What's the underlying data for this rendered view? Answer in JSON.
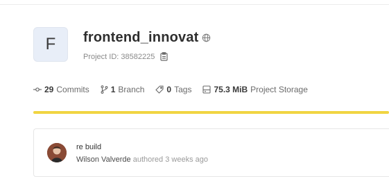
{
  "project": {
    "avatar_letter": "F",
    "name": "frontend_innovat",
    "id_label": "Project ID: 38582225",
    "visibility_icon": "globe-icon",
    "copy_icon": "clipboard-icon"
  },
  "stats": {
    "commits": {
      "count": "29",
      "label": "Commits",
      "icon": "commit-icon"
    },
    "branches": {
      "count": "1",
      "label": "Branch",
      "icon": "branch-icon"
    },
    "tags": {
      "count": "0",
      "label": "Tags",
      "icon": "tag-icon"
    },
    "storage": {
      "count": "75.3 MiB",
      "label": "Project Storage",
      "icon": "storage-icon"
    }
  },
  "progress_bar": {
    "color": "#f1d542"
  },
  "last_commit": {
    "message": "re build",
    "author": "Wilson Valverde",
    "action": "authored",
    "time": "3 weeks ago"
  }
}
